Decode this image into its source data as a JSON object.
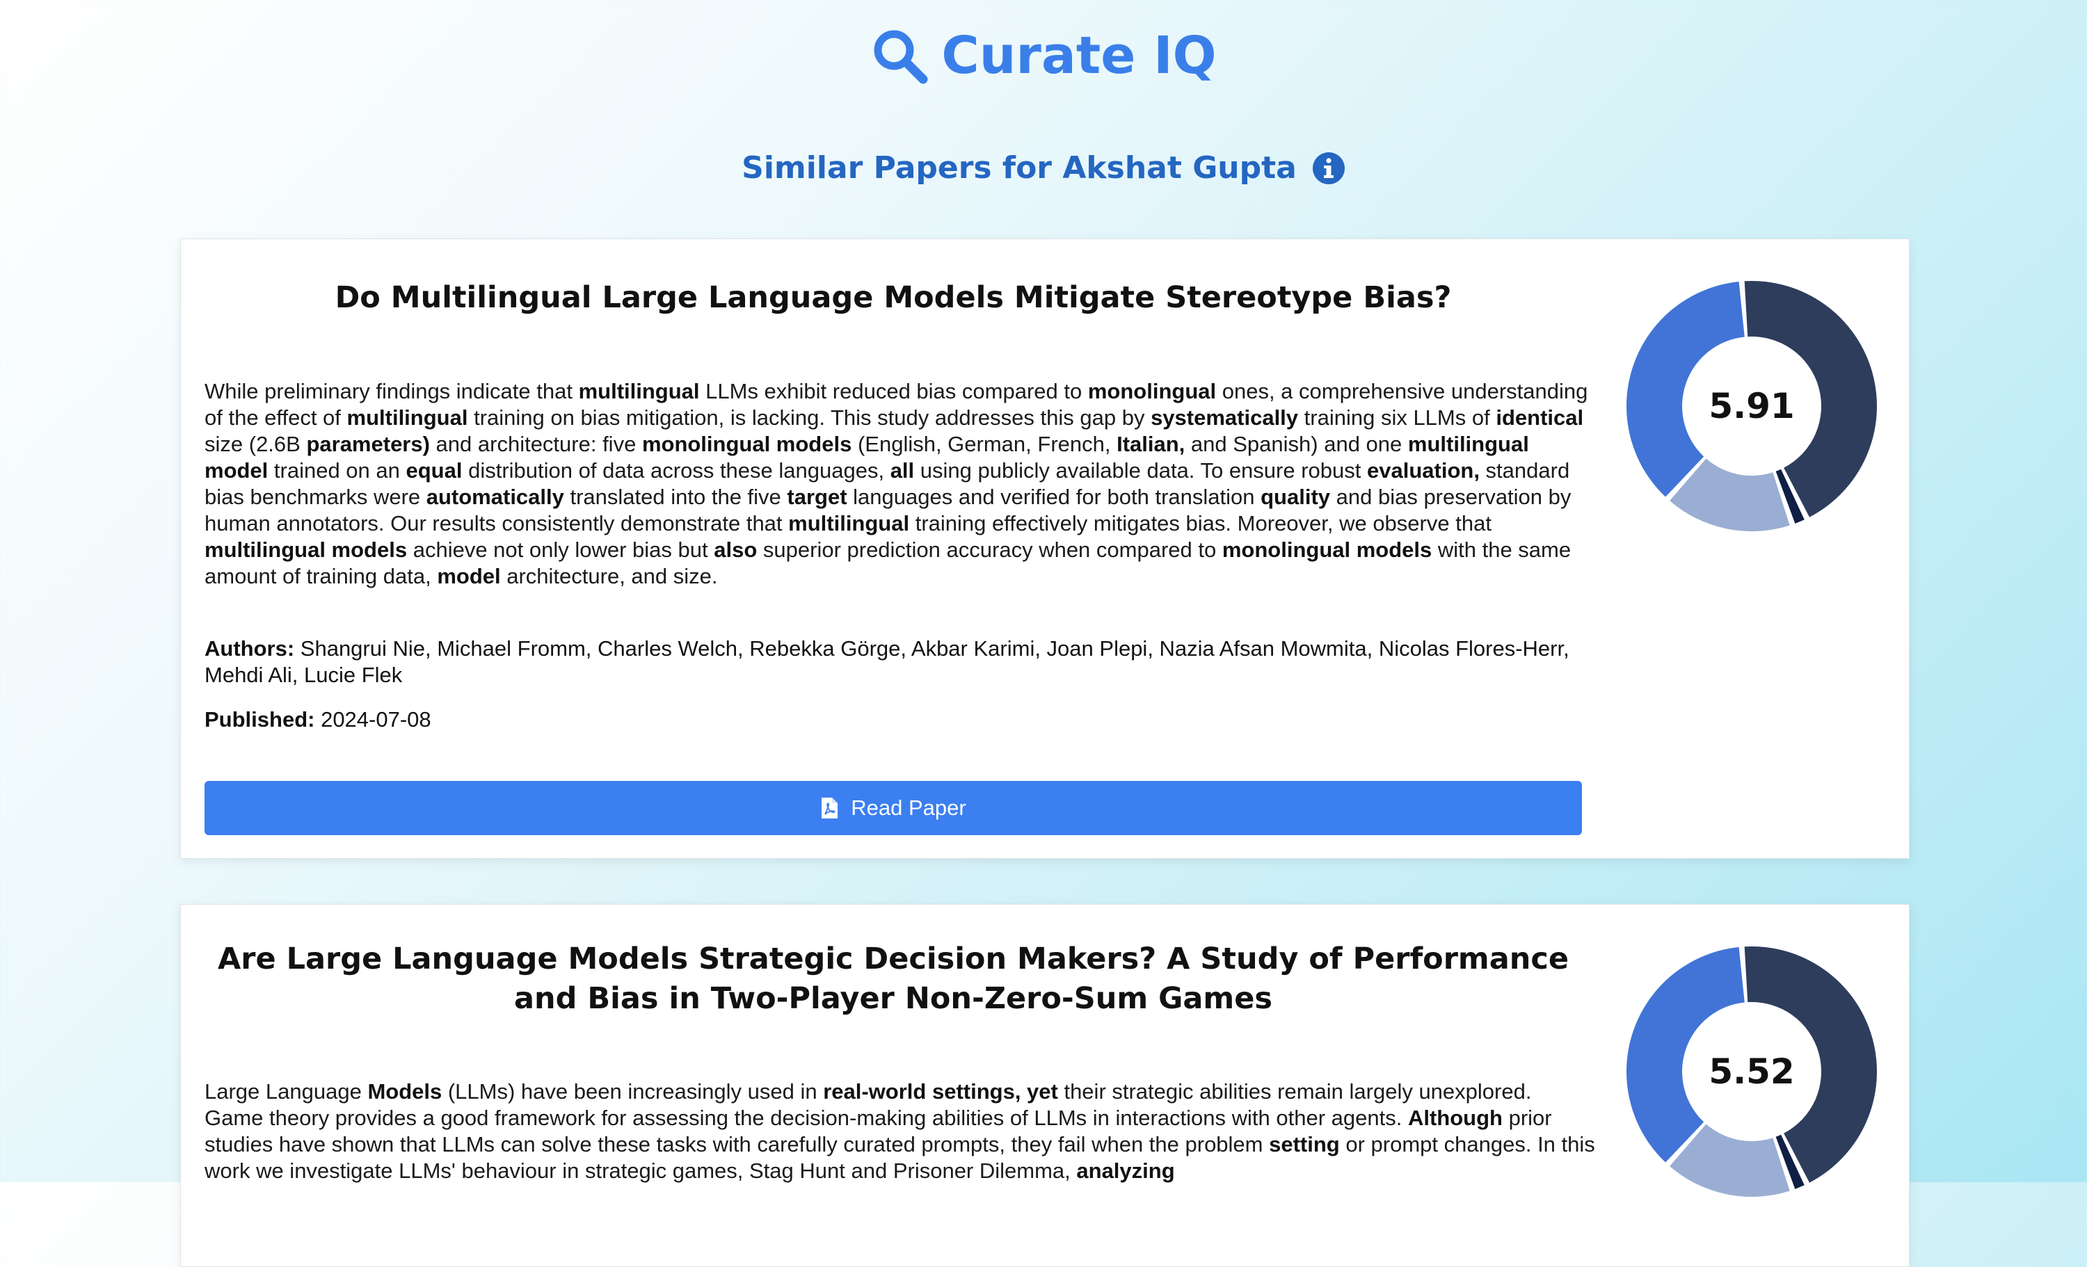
{
  "app": {
    "name": "Curate IQ",
    "brand_color": "#3a7fe9"
  },
  "header": {
    "subtitle": "Similar Papers for Akshat Gupta",
    "info_icon": "info-circle-icon"
  },
  "labels": {
    "authors": "Authors:",
    "published": "Published:",
    "read_button": "Read Paper"
  },
  "papers": [
    {
      "title": "Do Multilingual Large Language Models Mitigate Stereotype Bias?",
      "abstract": "While preliminary findings indicate that **multilingual** LLMs exhibit reduced bias compared to **monolingual** ones, a comprehensive understanding of the effect of **multilingual** training on bias mitigation, is lacking. This study addresses this gap by **systematically** training six LLMs of **identical** size (2.6B **parameters)** and architecture: five **monolingual models** (English, German, French, **Italian,** and Spanish) and one **multilingual model** trained on an **equal** distribution of data across these languages, **all** using publicly available data. To ensure robust **evaluation,** standard bias benchmarks were **automatically** translated into the five **target** languages and verified for both translation **quality** and bias preservation by human annotators. Our results consistently demonstrate that **multilingual** training effectively mitigates bias. Moreover, we observe that **multilingual models** achieve not only lower bias but **also** superior prediction accuracy when compared to **monolingual models** with the same amount of training data, **model** architecture, and size.",
      "authors": "Shangrui Nie, Michael Fromm, Charles Welch, Rebekka Görge, Akbar Karimi, Joan Plepi, Nazia Afsan Mowmita, Nicolas Flores-Herr, Mehdi Ali, Lucie Flek",
      "published": "2024-07-08",
      "score": "5.91"
    },
    {
      "title": "Are Large Language Models Strategic Decision Makers? A Study of Performance and Bias in Two-Player Non-Zero-Sum Games",
      "abstract": "Large Language **Models** (LLMs) have been increasingly used in **real-world settings, yet** their strategic abilities remain largely unexplored. Game theory provides a good framework for assessing the decision-making abilities of LLMs in interactions with other agents. **Although** prior studies have shown that LLMs can solve these tasks with carefully curated prompts, they fail when the problem **setting** or prompt changes. In this work we investigate LLMs' behaviour in strategic games, Stag Hunt and Prisoner Dilemma, **analyzing**",
      "score": "5.52"
    }
  ],
  "chart_data": [
    {
      "type": "pie",
      "score": "5.91",
      "slices": [
        {
          "value": 44,
          "color": "#2e3d5c"
        },
        {
          "value": 2,
          "color": "#0f1f45"
        },
        {
          "value": 17,
          "color": "#9aaed3"
        },
        {
          "value": 37,
          "color": "#4174d6"
        }
      ]
    },
    {
      "type": "pie",
      "score": "5.52",
      "slices": [
        {
          "value": 44,
          "color": "#2e3d5c"
        },
        {
          "value": 2,
          "color": "#0f1f45"
        },
        {
          "value": 17,
          "color": "#9aaed3"
        },
        {
          "value": 37,
          "color": "#4174d6"
        }
      ]
    }
  ]
}
